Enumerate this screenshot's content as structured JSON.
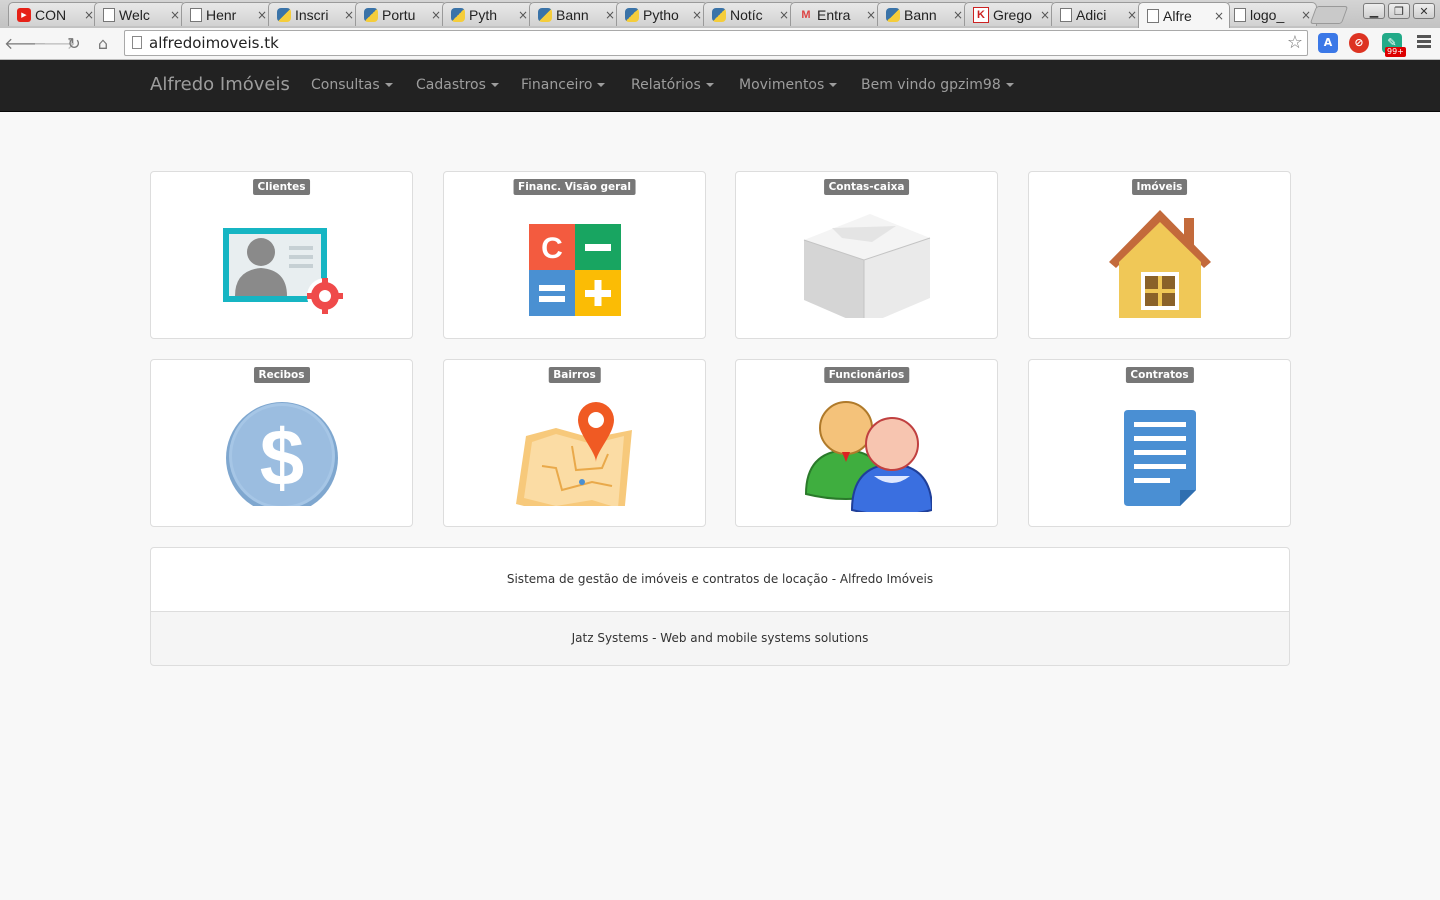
{
  "browser": {
    "tabs": [
      {
        "title": "CON",
        "favicon": "youtube-icon"
      },
      {
        "title": "Welc",
        "favicon": "page-icon"
      },
      {
        "title": "Henr",
        "favicon": "page-icon"
      },
      {
        "title": "Inscri",
        "favicon": "python-icon"
      },
      {
        "title": "Portu",
        "favicon": "python-icon"
      },
      {
        "title": "Pyth",
        "favicon": "python-icon"
      },
      {
        "title": "Bann",
        "favicon": "python-icon"
      },
      {
        "title": "Pytho",
        "favicon": "python-icon"
      },
      {
        "title": "Notíc",
        "favicon": "python-icon"
      },
      {
        "title": "Entra",
        "favicon": "gmail-icon"
      },
      {
        "title": "Bann",
        "favicon": "python-icon"
      },
      {
        "title": "Grego",
        "favicon": "k-icon"
      },
      {
        "title": "Adici",
        "favicon": "page-icon"
      },
      {
        "title": "Alfre",
        "favicon": "page-icon",
        "active": true
      },
      {
        "title": "logo_",
        "favicon": "page-icon"
      }
    ],
    "close_glyph": "×",
    "url": "alfredoimoveis.tk",
    "extension_badge": "99+"
  },
  "navbar": {
    "brand": "Alfredo Imóveis",
    "items": [
      "Consultas",
      "Cadastros",
      "Financeiro",
      "Relatórios",
      "Movimentos",
      "Bem vindo gpzim98"
    ]
  },
  "tiles": [
    {
      "label": "Clientes",
      "icon": "client-card-icon"
    },
    {
      "label": "Financ. Visão geral",
      "icon": "calculator-icon"
    },
    {
      "label": "Contas-caixa",
      "icon": "box-icon"
    },
    {
      "label": "Imóveis",
      "icon": "house-icon"
    },
    {
      "label": "Recibos",
      "icon": "dollar-coin-icon"
    },
    {
      "label": "Bairros",
      "icon": "map-pin-icon"
    },
    {
      "label": "Funcionários",
      "icon": "users-icon"
    },
    {
      "label": "Contratos",
      "icon": "document-icon"
    }
  ],
  "footer": {
    "description": "Sistema de gestão de imóveis e contratos de locação - Alfredo Imóveis",
    "credits": "Jatz Systems - Web and mobile systems solutions"
  },
  "colors": {
    "navbar_bg": "#222222",
    "label_bg": "#777777",
    "page_bg": "#f8f8f8"
  }
}
